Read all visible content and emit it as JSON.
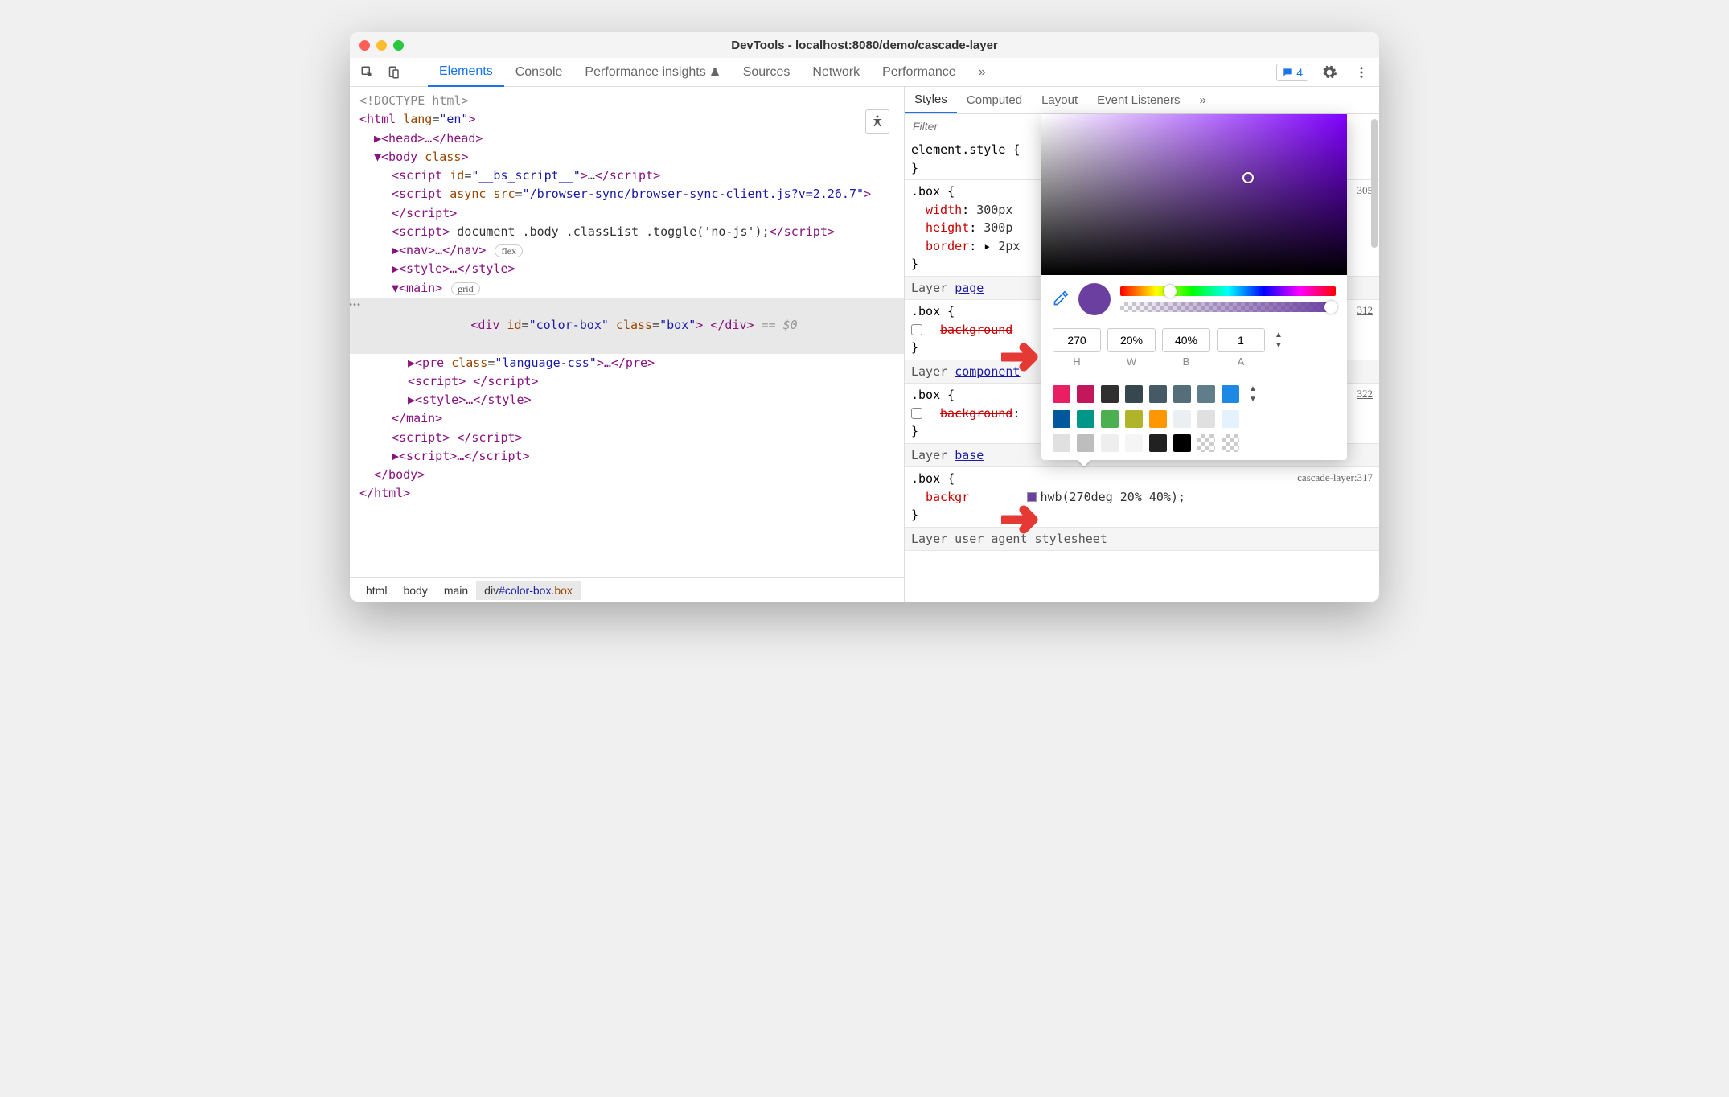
{
  "window_title": "DevTools - localhost:8080/demo/cascade-layer",
  "main_tabs": [
    "Elements",
    "Console",
    "Performance insights",
    "Sources",
    "Network",
    "Performance"
  ],
  "badge_count": "4",
  "dom": {
    "doctype": "<!DOCTYPE html>",
    "html_open": "<html lang=\"en\">",
    "head": "▶<head>…</head>",
    "body_open": "▼<body class>",
    "s1a": "<script id=\"__bs_script__\">",
    "s1b": "…",
    "s1c": "</script>",
    "s2a": "<script async src=\"",
    "s2link": "/browser-sync/browser-sync-client.js?v=2.26.7",
    "s2b": "\"></script>",
    "s3a": "<script>",
    "s3txt": " document .body .classList .toggle('no-js');",
    "s3b": "</script>",
    "nav": "▶<nav>…</nav>",
    "nav_chip": "flex",
    "style1": "▶<style>…</style>",
    "main_open": "▼<main>",
    "main_chip": "grid",
    "sel_a": "<div id=\"color-box\" class=\"box\">",
    "sel_b": " </div>",
    "sel_eq": " == $0",
    "pre": "▶<pre class=\"language-css\">…</pre>",
    "s4": "<script> </script>",
    "style2": "▶<style>…</style>",
    "main_close": "</main>",
    "s5": "<script> </script>",
    "s6": "▶<script>…</script>",
    "body_close": "</body>",
    "html_close": "</html>"
  },
  "crumbs": [
    "html",
    "body",
    "main",
    "div#color-box.box"
  ],
  "styles": {
    "tabs": [
      "Styles",
      "Computed",
      "Layout",
      "Event Listeners"
    ],
    "filter": "Filter",
    "elem_style": "element.style {",
    "box_sel": ".box {",
    "box_width": "width: 300px",
    "box_height": "height: 300p",
    "box_border": "border: ▸ 2px",
    "layer_page": "Layer page",
    "bg_striked": "background",
    "layer_component": "Layer component",
    "layer_base": "Layer base",
    "bg_label": "backgr",
    "hwb_text": "hwb(270deg 20% 40%);",
    "src_305": "305",
    "src_312": "312",
    "src_322": "322",
    "src_317": "cascade-layer:317",
    "user_agent": "Layer user agent stylesheet"
  },
  "picker": {
    "h": "270",
    "w": "20%",
    "b": "40%",
    "a": "1",
    "labels": [
      "H",
      "W",
      "B",
      "A"
    ],
    "preview": "#6b3fa0",
    "palette_row1": [
      "#e91e63",
      "#c2185b",
      "#303030",
      "#37474f",
      "#455a64",
      "#546e7a",
      "#607d8b",
      "#1e88e5"
    ],
    "palette_row2": [
      "#01579b",
      "#009688",
      "#4caf50",
      "#afb42b",
      "#ff9800",
      "#eceff1",
      "#e0e0e0",
      "#e3f2fd"
    ],
    "palette_row3": [
      "#e0e0e0",
      "#bdbdbd",
      "#eeeeee",
      "#f5f5f5",
      "#212121",
      "#000000",
      "chk",
      "chk"
    ]
  }
}
